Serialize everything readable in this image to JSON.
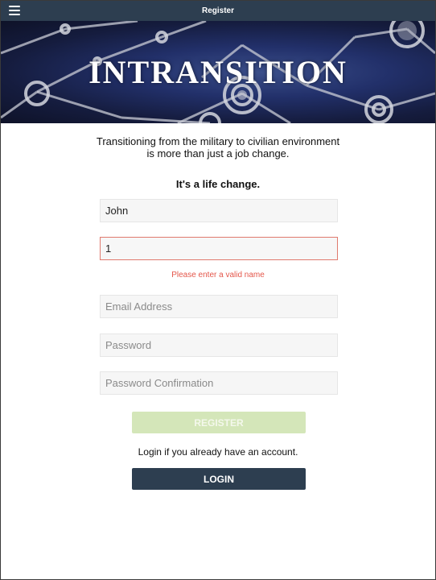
{
  "topbar": {
    "title": "Register",
    "menu_icon": "hamburger-menu-icon",
    "background": "#2d3e50"
  },
  "hero": {
    "title": "INTRANSITION"
  },
  "intro": {
    "line1": "Transitioning from the military to civilian environment",
    "line2": "is more than just a job change.",
    "emphasis": "It's a life change."
  },
  "form": {
    "first_name": {
      "value": "John",
      "placeholder": ""
    },
    "last_name": {
      "value": "1",
      "placeholder": ""
    },
    "last_name_error": "Please enter a valid name",
    "email": {
      "value": "",
      "placeholder": "Email Address"
    },
    "password": {
      "value": "",
      "placeholder": "Password"
    },
    "password_confirmation": {
      "value": "",
      "placeholder": "Password Confirmation"
    },
    "register_label": "REGISTER",
    "register_color": "#d4e6b9"
  },
  "login": {
    "hint": "Login if you already have an account.",
    "button_label": "LOGIN",
    "button_color": "#2d3e50"
  },
  "colors": {
    "error": "#e4564a",
    "error_border": "#e07a6e"
  }
}
